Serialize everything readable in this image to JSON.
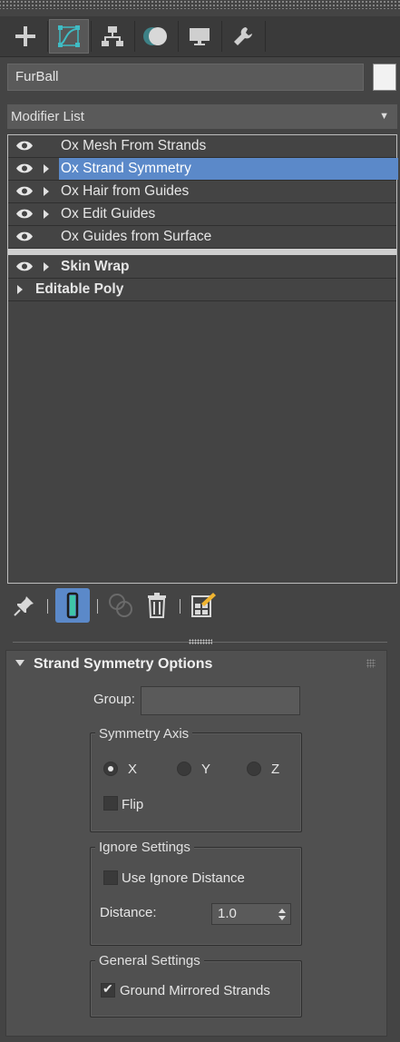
{
  "object_name": "FurBall",
  "object_color": "#f2f2f2",
  "modifier_list": {
    "label": "Modifier List"
  },
  "tabs": [
    {
      "name": "create",
      "icon": "plus-icon"
    },
    {
      "name": "modify",
      "icon": "modify-curve-icon",
      "active": true
    },
    {
      "name": "hierarchy",
      "icon": "hierarchy-icon"
    },
    {
      "name": "motion",
      "icon": "motion-icon"
    },
    {
      "name": "display",
      "icon": "display-monitor-icon"
    },
    {
      "name": "utilities",
      "icon": "wrench-icon"
    }
  ],
  "stack": {
    "items": [
      {
        "label": "Ox Mesh From Strands",
        "eye": true,
        "expand": false,
        "selected": false
      },
      {
        "label": "Ox Strand Symmetry",
        "eye": true,
        "expand": true,
        "selected": true
      },
      {
        "label": "Ox Hair from Guides",
        "eye": true,
        "expand": true,
        "selected": false
      },
      {
        "label": "Ox Edit Guides",
        "eye": true,
        "expand": true,
        "selected": false
      },
      {
        "label": "Ox Guides from Surface",
        "eye": true,
        "expand": false,
        "selected": false
      }
    ],
    "base_items": [
      {
        "label": "Skin Wrap",
        "eye": true,
        "expand": true
      },
      {
        "label": "Editable Poly",
        "eye": false,
        "expand": true
      }
    ]
  },
  "toolbar": {
    "pin": "pin-icon",
    "show_end_result": "show-end-result-icon",
    "make_unique": "make-unique-icon",
    "remove_modifier": "trash-icon",
    "configure_sets": "configure-modifier-sets-icon"
  },
  "rollout": {
    "title": "Strand Symmetry Options",
    "group_label": "Group:",
    "group_value": "",
    "symmetry_axis": {
      "title": "Symmetry Axis",
      "options": [
        "X",
        "Y",
        "Z"
      ],
      "selected": "X",
      "flip_label": "Flip",
      "flip_checked": false
    },
    "ignore_settings": {
      "title": "Ignore Settings",
      "use_ignore_label": "Use Ignore Distance",
      "use_ignore_checked": false,
      "distance_label": "Distance:",
      "distance_value": "1.0"
    },
    "general_settings": {
      "title": "General Settings",
      "ground_label": "Ground Mirrored Strands",
      "ground_checked": true
    }
  },
  "colors": {
    "selection": "#5b89c9",
    "panel": "#444444",
    "accent_teal": "#3fbcc4"
  }
}
